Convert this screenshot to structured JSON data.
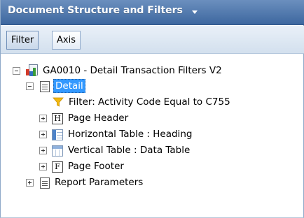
{
  "panel": {
    "title": "Document Structure and Filters"
  },
  "tabs": [
    {
      "label": "Filter",
      "active": true
    },
    {
      "label": "Axis",
      "active": false
    }
  ],
  "tree": {
    "root": {
      "label": "GA0010 - Detail Transaction Filters V2",
      "icon": "report-icon",
      "expanded": true
    },
    "detail": {
      "label": "Detail",
      "icon": "document-icon",
      "expanded": true,
      "selected": true
    },
    "filter": {
      "label": "Filter: Activity Code Equal to C755",
      "icon": "filter-icon"
    },
    "page_header": {
      "label": "Page Header",
      "icon": "page-header-icon",
      "icon_letter": "H",
      "expanded": false
    },
    "horizontal_table": {
      "label": "Horizontal Table : Heading",
      "icon": "horizontal-table-icon",
      "expanded": false
    },
    "vertical_table": {
      "label": "Vertical Table : Data Table",
      "icon": "vertical-table-icon",
      "expanded": false
    },
    "page_footer": {
      "label": "Page Footer",
      "icon": "page-footer-icon",
      "icon_letter": "F",
      "expanded": false
    },
    "report_parameters": {
      "label": "Report Parameters",
      "icon": "document-icon",
      "expanded": false
    }
  },
  "colors": {
    "header_gradient_top": "#6b8fbe",
    "header_gradient_bottom": "#3d679f",
    "selection": "#3399ff",
    "filter_funnel": "#f2b90f"
  }
}
